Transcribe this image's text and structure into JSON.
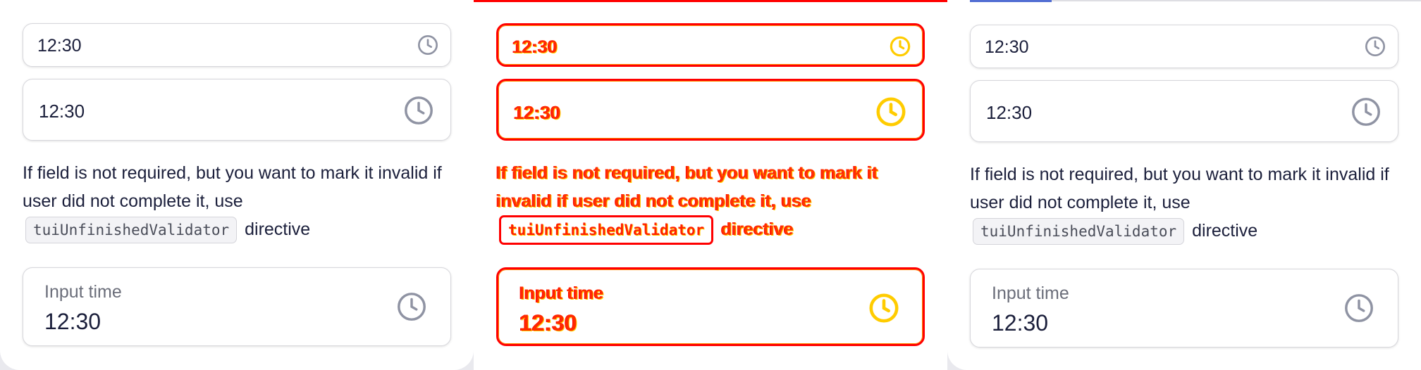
{
  "panels": [
    {
      "id": "reference",
      "small_field": {
        "value": "12:30",
        "icon": "clock-icon"
      },
      "medium_field": {
        "value": "12:30",
        "icon": "clock-icon"
      },
      "description": {
        "before": "If field is not required, but you want to mark it invalid if user did not complete it, use",
        "code": "tuiUnfinishedValidator",
        "after": "directive"
      },
      "large_field": {
        "label": "Input time",
        "value": "12:30",
        "icon": "clock-icon"
      }
    },
    {
      "id": "diff",
      "small_field": {
        "value": "12:30",
        "icon": "clock-icon"
      },
      "medium_field": {
        "value": "12:30",
        "icon": "clock-icon"
      },
      "description": {
        "before": "If field is not required, but you want to mark it invalid if user did not complete it, use",
        "code": "tuiUnfinishedValidator",
        "after": "directive"
      },
      "large_field": {
        "label": "Input time",
        "value": "12:30",
        "icon": "clock-icon"
      }
    },
    {
      "id": "current",
      "small_field": {
        "value": "12:30",
        "icon": "clock-icon"
      },
      "medium_field": {
        "value": "12:30",
        "icon": "clock-icon"
      },
      "description": {
        "before": "If field is not required, but you want to mark it invalid if user did not complete it, use",
        "code": "tuiUnfinishedValidator",
        "after": "directive"
      },
      "large_field": {
        "label": "Input time",
        "value": "12:30",
        "icon": "clock-icon"
      }
    }
  ],
  "colors": {
    "accent_diff": "#ff0000",
    "accent_blue": "#526ed3",
    "text": "#1b1f3b",
    "icon": "#8f93a3"
  }
}
